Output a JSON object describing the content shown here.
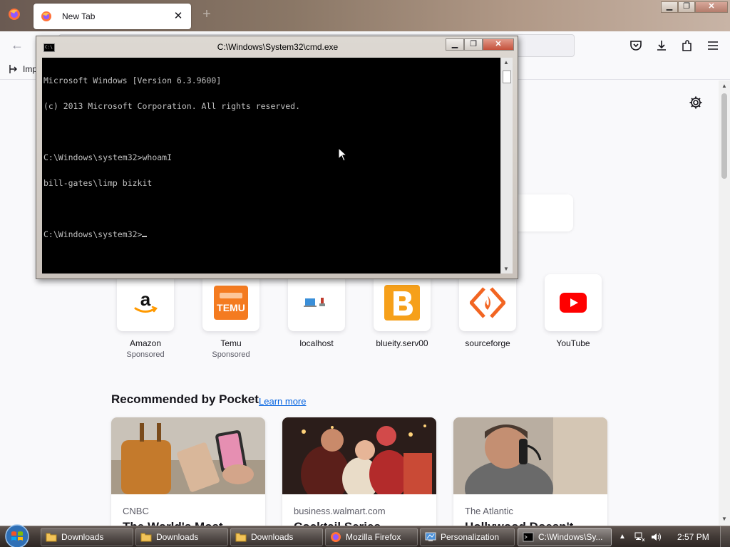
{
  "browser": {
    "tab_title": "New Tab",
    "tab_close": "✕",
    "new_tab": "+",
    "back": "←",
    "bookmark_import": "Imp"
  },
  "window_controls": {
    "min": "▁",
    "max": "❐",
    "close": "✕"
  },
  "top_sites": [
    {
      "label": "Amazon",
      "sponsored": "Sponsored",
      "icon": "amazon-icon"
    },
    {
      "label": "Temu",
      "sponsored": "Sponsored",
      "icon": "temu-icon"
    },
    {
      "label": "localhost",
      "sponsored": "",
      "icon": "localhost-icon"
    },
    {
      "label": "blueity.serv00",
      "sponsored": "",
      "icon": "blueity-icon"
    },
    {
      "label": "sourceforge",
      "sponsored": "",
      "icon": "sourceforge-icon"
    },
    {
      "label": "YouTube",
      "sponsored": "",
      "icon": "youtube-icon"
    }
  ],
  "temu_logo_text": "TEMU",
  "pocket": {
    "heading": "Recommended by Pocket",
    "learn_more": "Learn more",
    "cards": [
      {
        "source": "CNBC",
        "headline": "The World's Most"
      },
      {
        "source": "business.walmart.com",
        "headline": "Cocktail Series"
      },
      {
        "source": "The Atlantic",
        "headline": "Hollywood Doesn't"
      }
    ]
  },
  "cmd": {
    "title": "C:\\Windows\\System32\\cmd.exe",
    "icon_text": "C:\\",
    "lines": [
      "Microsoft Windows [Version 6.3.9600]",
      "(c) 2013 Microsoft Corporation. All rights reserved.",
      "",
      "C:\\Windows\\system32>whoamI",
      "bill-gates\\limp bizkit",
      "",
      "C:\\Windows\\system32>"
    ]
  },
  "taskbar": {
    "items": [
      {
        "label": "Downloads",
        "icon": "folder-icon"
      },
      {
        "label": "Downloads",
        "icon": "folder-icon"
      },
      {
        "label": "Downloads",
        "icon": "folder-icon"
      },
      {
        "label": "Mozilla Firefox",
        "icon": "firefox-icon"
      },
      {
        "label": "Personalization",
        "icon": "personalization-icon"
      },
      {
        "label": "C:\\Windows\\Sy...",
        "icon": "cmd-icon"
      }
    ],
    "clock": "2:57 PM"
  },
  "colors": {
    "link": "#0061e0",
    "youtube_red": "#ff0000",
    "temu_orange": "#f47b20",
    "blueity_orange": "#f6a01a",
    "sourceforge_orange": "#f26522"
  }
}
